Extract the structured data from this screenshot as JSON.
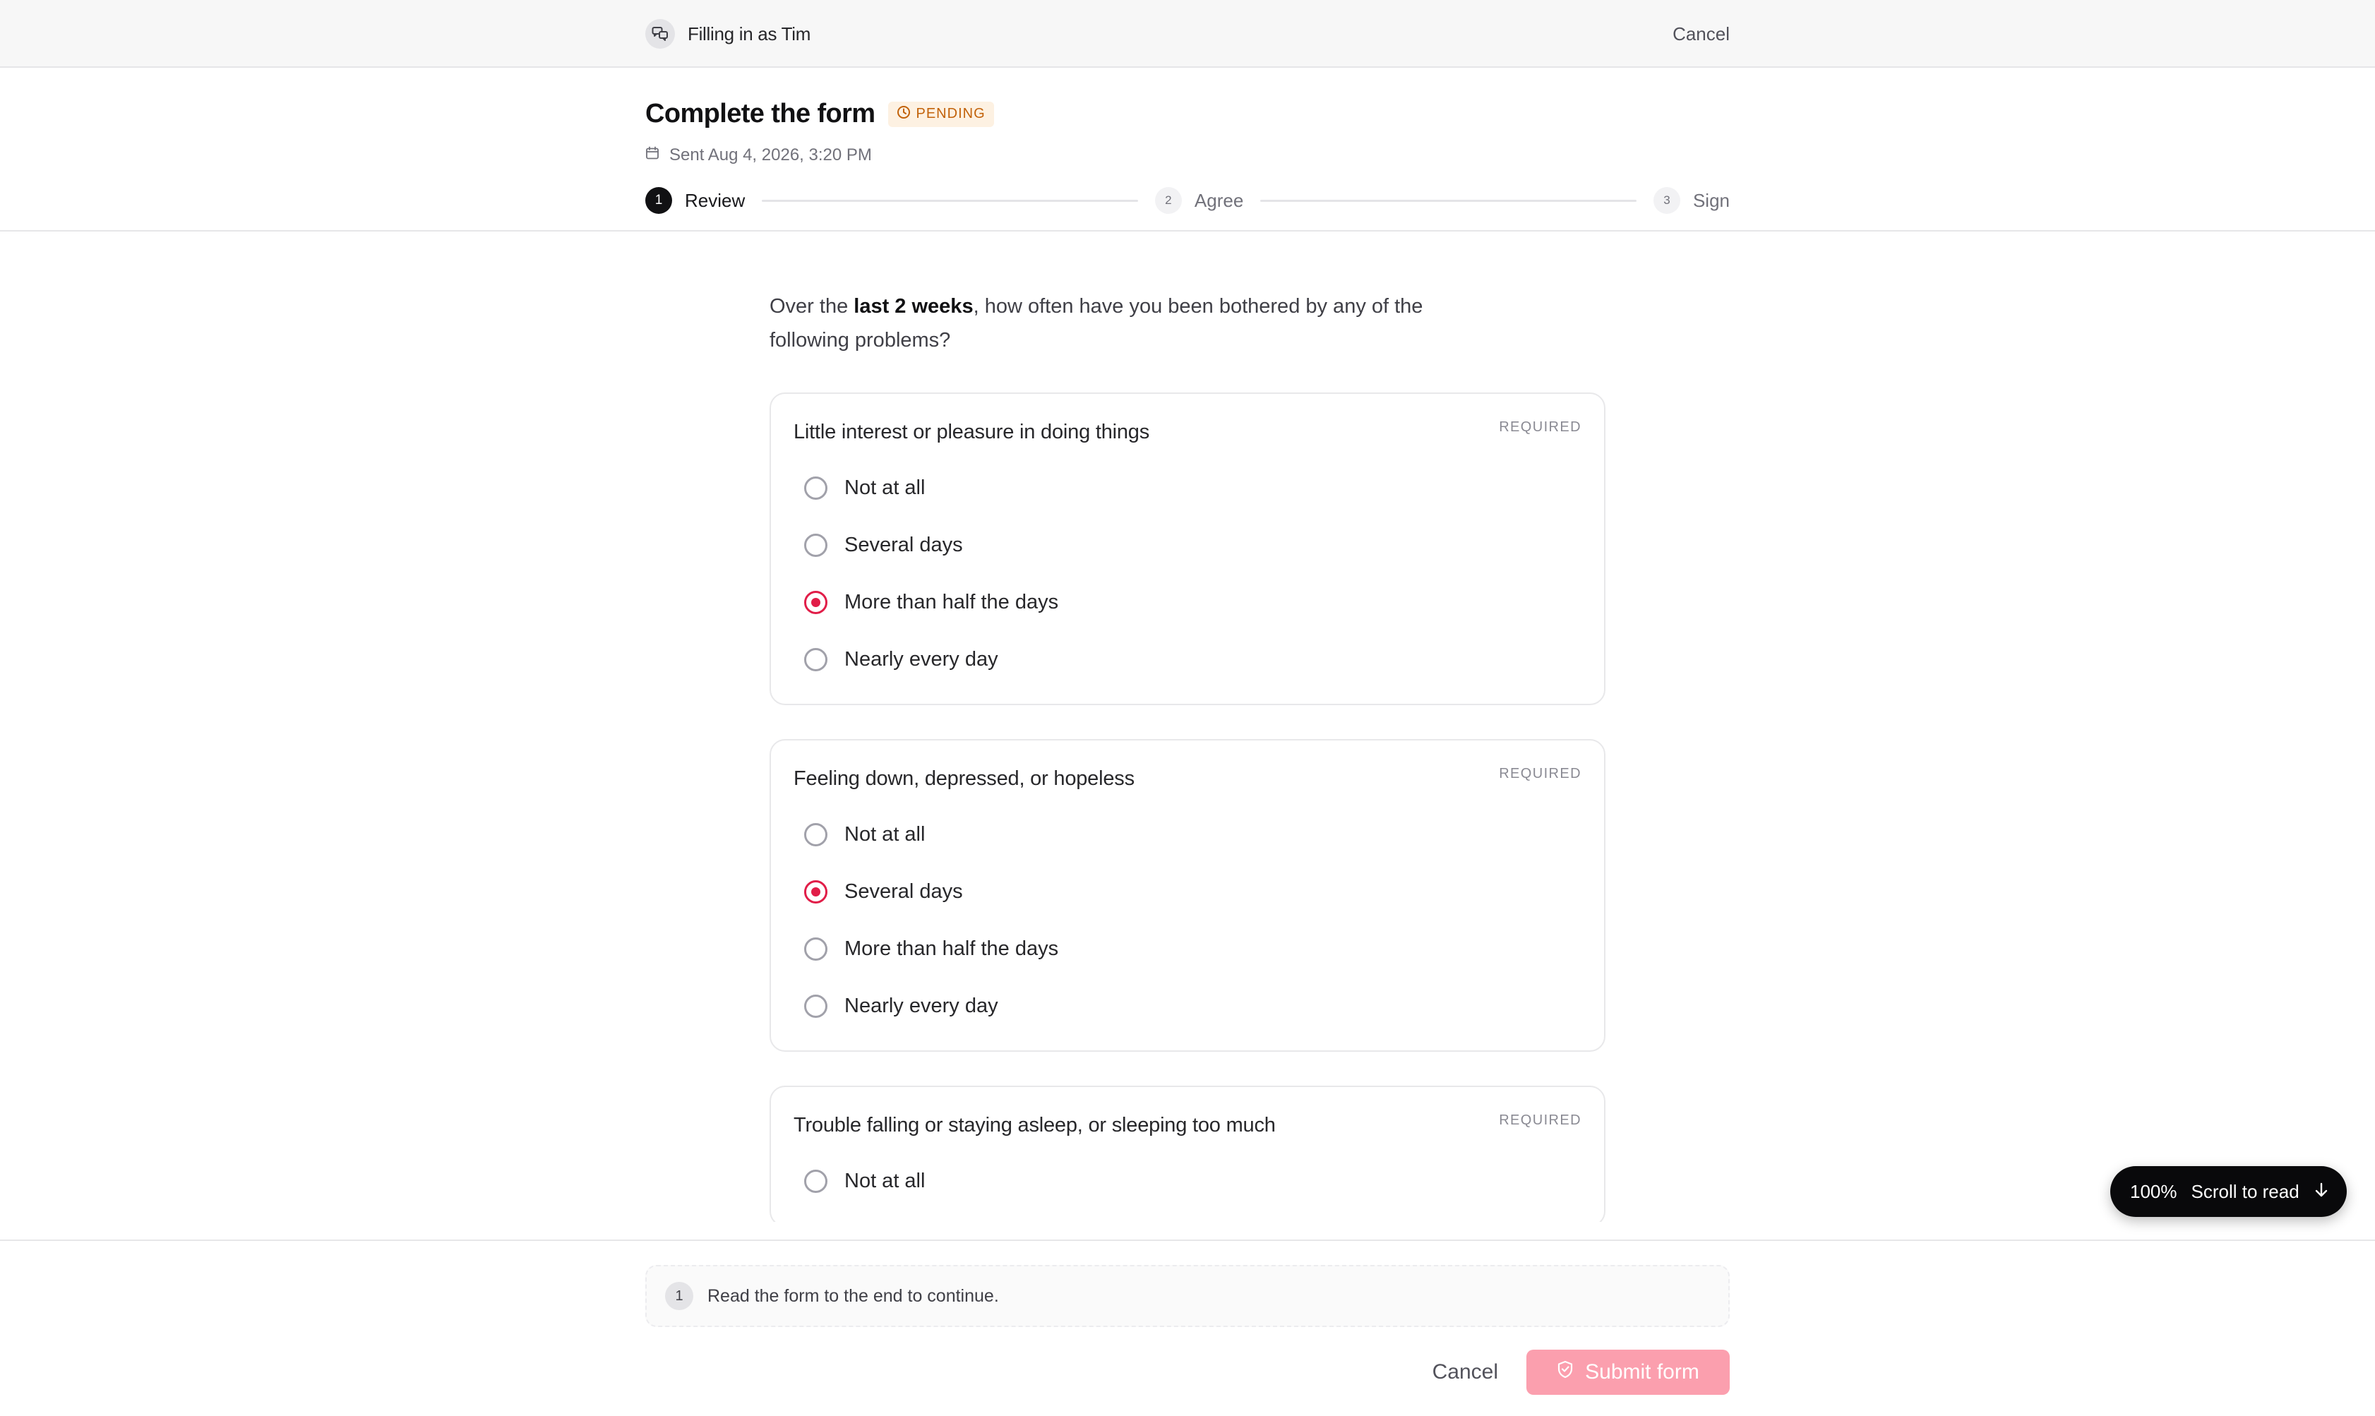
{
  "topbar": {
    "filling_as": "Filling in as Tim",
    "cancel_label": "Cancel"
  },
  "header": {
    "title": "Complete the form",
    "status_badge": "PENDING",
    "sent_text": "Sent Aug 4, 2026, 3:20 PM",
    "steps": [
      {
        "num": "1",
        "label": "Review",
        "active": true
      },
      {
        "num": "2",
        "label": "Agree",
        "active": false
      },
      {
        "num": "3",
        "label": "Sign",
        "active": false
      }
    ]
  },
  "intro": {
    "prefix": "Over the ",
    "emphasis": "last 2 weeks",
    "suffix": ", how often have you been bothered by any of the following problems?"
  },
  "questions": [
    {
      "title": "Little interest or pleasure in doing things",
      "required_label": "REQUIRED",
      "options": [
        {
          "label": "Not at all",
          "checked": false
        },
        {
          "label": "Several days",
          "checked": false
        },
        {
          "label": "More than half the days",
          "checked": true
        },
        {
          "label": "Nearly every day",
          "checked": false
        }
      ]
    },
    {
      "title": "Feeling down, depressed, or hopeless",
      "required_label": "REQUIRED",
      "options": [
        {
          "label": "Not at all",
          "checked": false
        },
        {
          "label": "Several days",
          "checked": true
        },
        {
          "label": "More than half the days",
          "checked": false
        },
        {
          "label": "Nearly every day",
          "checked": false
        }
      ]
    },
    {
      "title": "Trouble falling or staying asleep, or sleeping too much",
      "required_label": "REQUIRED",
      "options": [
        {
          "label": "Not at all",
          "checked": false
        }
      ]
    }
  ],
  "scroll_pill": {
    "percent": "100%",
    "label": "Scroll to read"
  },
  "footer": {
    "notice_num": "1",
    "notice_text": "Read the form to the end to continue.",
    "cancel_label": "Cancel",
    "submit_label": "Submit form"
  },
  "colors": {
    "accent": "#e11d48",
    "submit_disabled": "#fb9fae",
    "pending_text": "#c2620a",
    "pending_bg": "#fdf1e2"
  },
  "icons": {
    "who": "chat-bubbles-icon",
    "pending": "clock-icon",
    "sent": "calendar-icon",
    "scroll": "arrow-down-icon",
    "submit": "shield-check-icon"
  }
}
